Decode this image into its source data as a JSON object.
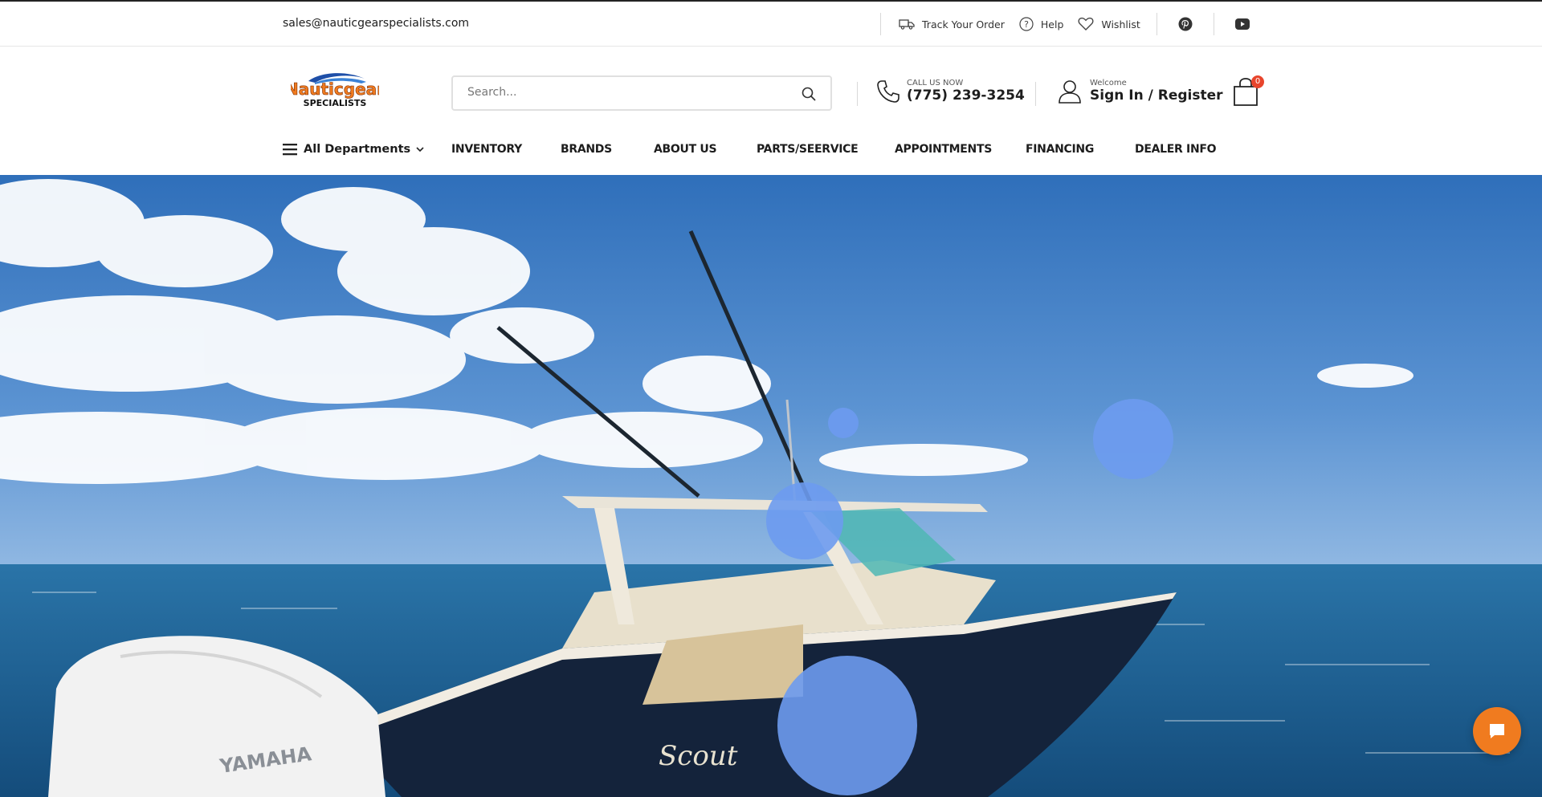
{
  "topbar": {
    "email": "sales@nauticgearspecialists.com",
    "links": [
      {
        "label": "Track Your Order",
        "icon": "truck-icon"
      },
      {
        "label": "Help",
        "icon": "help-icon"
      },
      {
        "label": "Wishlist",
        "icon": "heart-icon"
      }
    ],
    "social": [
      "pinterest-icon",
      "youtube-icon"
    ]
  },
  "header": {
    "logo": {
      "line1": "Nauticgear",
      "line2": "SPECIALISTS"
    },
    "search": {
      "placeholder": "Search..."
    },
    "call": {
      "label": "CALL US NOW",
      "phone": "(775) 239-3254"
    },
    "account": {
      "label": "Welcome",
      "action": "Sign In / Register"
    },
    "cart": {
      "count": "0"
    }
  },
  "nav": {
    "departments": "All Departments",
    "items": [
      "INVENTORY",
      "BRANDS",
      "ABOUT US",
      "PARTS/SEERVICE",
      "APPOINTMENTS",
      "FINANCING",
      "DEALER INFO"
    ]
  },
  "hero": {
    "outboard_brand": "YAMAHA",
    "boat_script": "Scout"
  },
  "colors": {
    "accent": "#f07b1f",
    "badge": "#e8452c",
    "sky": "#4f86c6",
    "sea": "#1f5f91",
    "overlay_circle": "#6d9bf0"
  }
}
